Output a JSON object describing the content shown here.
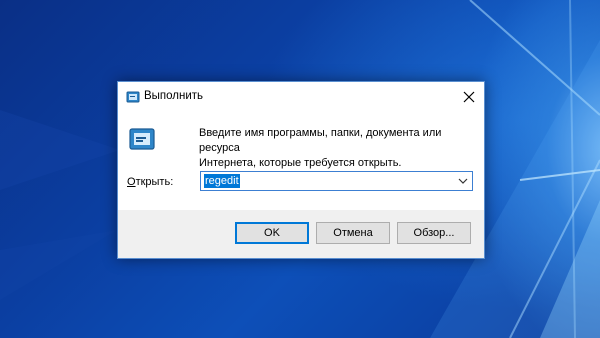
{
  "window": {
    "title": "Выполнить",
    "description_line1": "Введите имя программы, папки, документа или ресурса",
    "description_line2": "Интернета, которые требуется открыть.",
    "open_label_accel": "О",
    "open_label_rest": "ткрыть:",
    "input_value": "regedit"
  },
  "buttons": {
    "ok": "OK",
    "cancel": "Отмена",
    "browse": "Обзор..."
  },
  "icons": {
    "title": "run-icon",
    "content": "run-icon",
    "close": "close-icon",
    "dropdown": "chevron-down-icon"
  },
  "colors": {
    "accent": "#0078d7",
    "selection": "#0078d7",
    "dialog_bg": "#f0f0f0",
    "desktop": "#0b3fa2"
  }
}
